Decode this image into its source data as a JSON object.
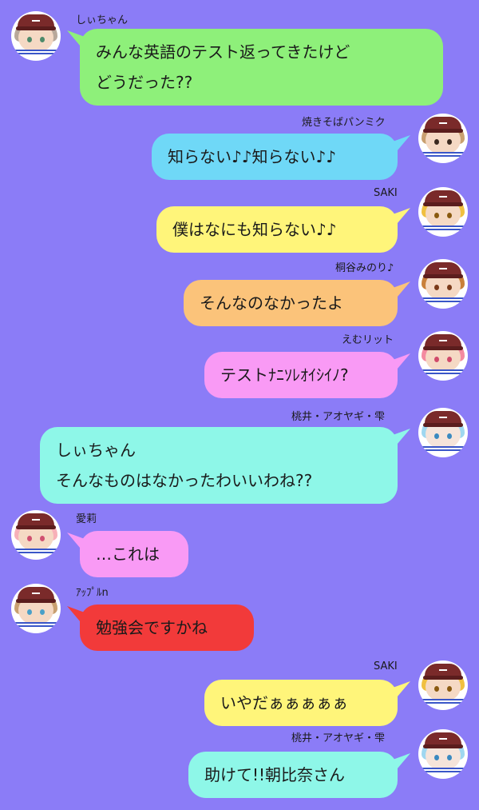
{
  "messages": [
    {
      "name": "しぃちゃん",
      "text": "みんな英語のテスト返ってきたけど\nどうだった??",
      "color": "#8ef07a",
      "side": "left",
      "avatar": {
        "hair": "#b8a89a",
        "eyes": "#4d8a6a",
        "skin": "#f5d9c4"
      }
    },
    {
      "name": "焼きそばパンミク",
      "text": "知らない♪♪知らない♪♪",
      "color": "#6fd8f7",
      "side": "right",
      "avatar": {
        "hair": "#c9a070",
        "eyes": "#3b2a20",
        "skin": "#f5d9c4"
      }
    },
    {
      "name": "SAKI",
      "text": "僕はなにも知らない♪♪",
      "color": "#fff57a",
      "side": "right",
      "avatar": {
        "hair": "#f0c040",
        "eyes": "#8a5a10",
        "skin": "#f5d9c4"
      }
    },
    {
      "name": "桐谷みのり♪",
      "text": "そんなのなかったよ",
      "color": "#fbc37a",
      "side": "right",
      "avatar": {
        "hair": "#c9803a",
        "eyes": "#7a3a1a",
        "skin": "#f5d9c4"
      }
    },
    {
      "name": "えむリット",
      "text": "テストﾅﾆｿﾚｵｲｼｲﾉ?",
      "color": "#f99af5",
      "side": "right",
      "avatar": {
        "hair": "#f48aa0",
        "eyes": "#d04a6a",
        "skin": "#f5d9c4"
      }
    },
    {
      "name": "桃井・アオヤギ・雫",
      "text": "しぃちゃん\nそんなものはなかったわいいわね??",
      "color": "#8ef7e8",
      "side": "right",
      "avatar": {
        "hair": "#9fd7f0",
        "eyes": "#3a8ac0",
        "skin": "#f5e4da"
      }
    },
    {
      "name": "愛莉",
      "text": "…これは",
      "color": "#f99af5",
      "side": "left",
      "avatar": {
        "hair": "#f7b0b8",
        "eyes": "#d05070",
        "skin": "#f5d9c4"
      }
    },
    {
      "name": "ｱｯﾌﾟﾙn",
      "text": "勉強会ですかね",
      "color": "#f23a3a",
      "side": "left",
      "avatar": {
        "hair": "#c9a070",
        "eyes": "#4aa0c8",
        "skin": "#f5d9c4"
      }
    },
    {
      "name": "SAKI",
      "text": "いやだぁぁぁぁぁ",
      "color": "#fff57a",
      "side": "right",
      "avatar": {
        "hair": "#f0c040",
        "eyes": "#8a5a10",
        "skin": "#f5d9c4"
      }
    },
    {
      "name": "桃井・アオヤギ・雫",
      "text": "助けて!!朝比奈さん",
      "color": "#8ef7e8",
      "side": "right",
      "avatar": {
        "hair": "#9fd7f0",
        "eyes": "#3a8ac0",
        "skin": "#f5e4da"
      }
    }
  ]
}
